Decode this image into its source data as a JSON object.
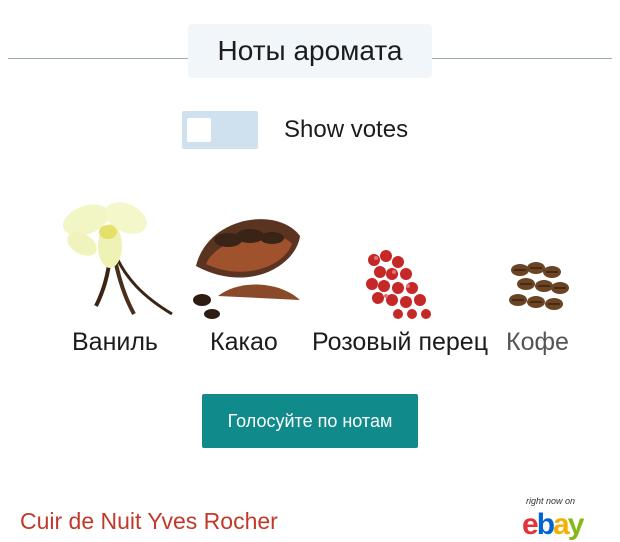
{
  "header": {
    "title": "Ноты аромата"
  },
  "votes_toggle": {
    "label": "Show votes",
    "checked": false
  },
  "notes": [
    {
      "label": "Ваниль",
      "icon": "vanilla-flower-image"
    },
    {
      "label": "Какао",
      "icon": "cocoa-pod-image"
    },
    {
      "label": "Розовый перец",
      "icon": "pink-pepper-image"
    },
    {
      "label": "Кофе",
      "icon": "coffee-beans-image"
    }
  ],
  "vote_button": {
    "label": "Голосуйте по нотам"
  },
  "product": {
    "name": "Cuir de Nuit Yves Rocher"
  },
  "ad": {
    "tagline": "right now on",
    "logo_letters": [
      "e",
      "b",
      "a",
      "y"
    ]
  },
  "colors": {
    "accent": "#108a8b",
    "link": "#c0392b",
    "header_bg": "#f1f6fb",
    "toggle_bg": "#cfe0ef"
  }
}
